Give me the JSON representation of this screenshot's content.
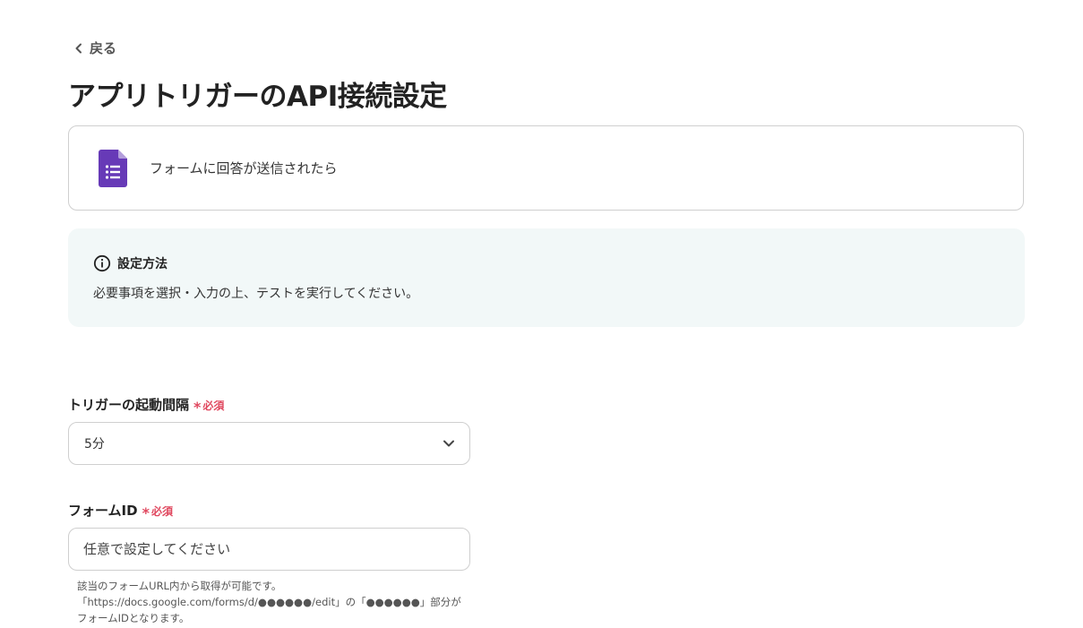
{
  "header": {
    "back_label": "戻る",
    "title": "アプリトリガーのAPI接続設定"
  },
  "trigger": {
    "icon": "google-forms-icon",
    "label": "フォームに回答が送信されたら",
    "icon_color": "#673ab7"
  },
  "info": {
    "heading": "設定方法",
    "text": "必要事項を選択・入力の上、テストを実行してください。",
    "background": "#f2f8f8"
  },
  "fields": {
    "interval": {
      "label": "トリガーの起動間隔",
      "required_label": "必須",
      "value": "5分"
    },
    "form_id": {
      "label": "フォームID",
      "required_label": "必須",
      "placeholder": "任意で設定してください",
      "value": "",
      "helper": "該当のフォームURL内から取得が可能です。\n「https://docs.google.com/forms/d/●●●●●●/edit」の「●●●●●●」部分がフォームIDとなります。"
    }
  },
  "colors": {
    "required": "#e0485f",
    "border": "#cfcfcf"
  }
}
